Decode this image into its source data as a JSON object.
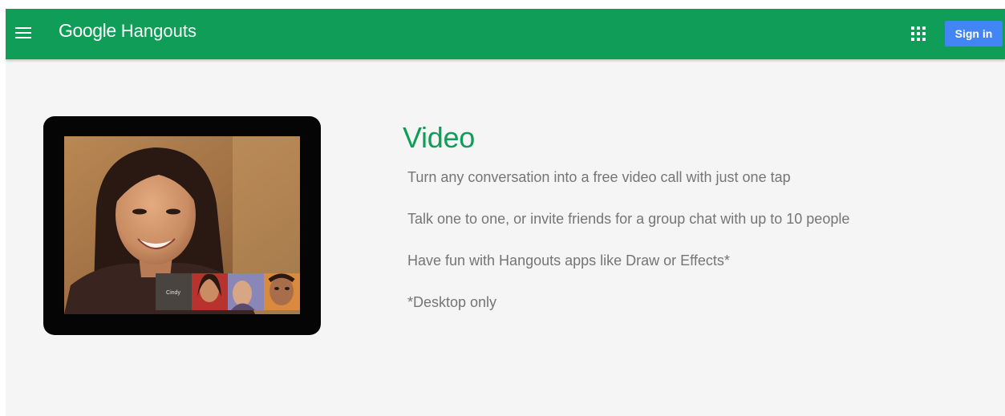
{
  "header": {
    "brand_google": "Google",
    "brand_product": "Hangouts",
    "menu_icon": "hamburger-menu-icon",
    "apps_icon": "apps-grid-icon",
    "signin_label": "Sign in",
    "bar_color": "#0f9d58",
    "signin_color": "#4285f4"
  },
  "hero": {
    "tablet_preview": {
      "caller_label": "Cindy"
    }
  },
  "feature": {
    "title": "Video",
    "title_color": "#0f9d58",
    "lines": [
      "Turn any conversation into a free video call with just one tap",
      "Talk one to one, or invite friends for a group chat with up to 10 people",
      "Have fun with Hangouts apps like Draw or Effects*",
      "*Desktop only"
    ]
  }
}
